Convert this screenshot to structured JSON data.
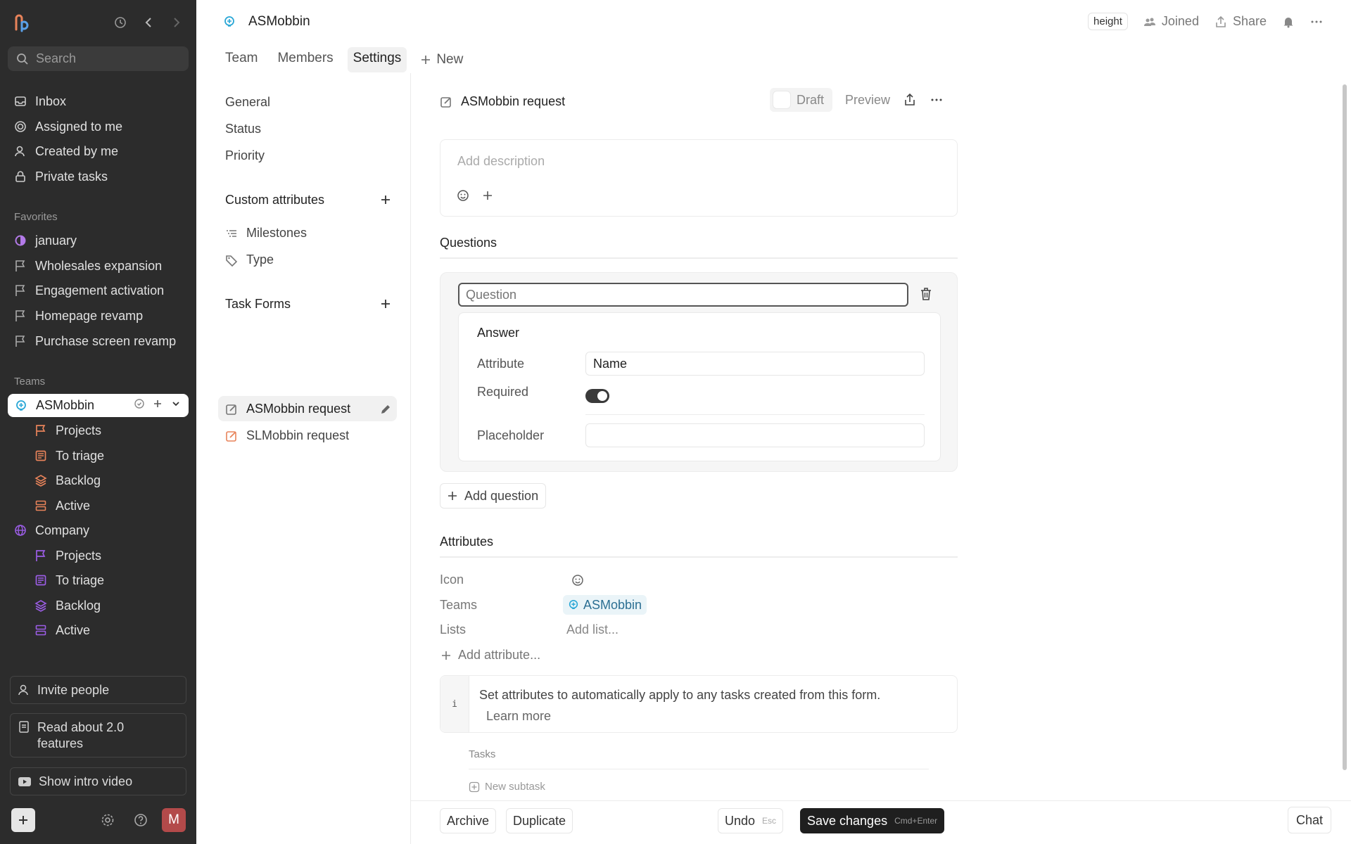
{
  "sidebar": {
    "search_placeholder": "Search",
    "nav": [
      {
        "label": "Inbox",
        "icon": "inbox-icon"
      },
      {
        "label": "Assigned to me",
        "icon": "target-icon"
      },
      {
        "label": "Created by me",
        "icon": "person-icon"
      },
      {
        "label": "Private tasks",
        "icon": "lock-icon"
      }
    ],
    "favorites_heading": "Favorites",
    "favorites": [
      {
        "label": "january",
        "icon": "circle-icon"
      },
      {
        "label": "Wholesales expansion",
        "icon": "flag-icon"
      },
      {
        "label": "Engagement activation",
        "icon": "flag-icon"
      },
      {
        "label": "Homepage revamp",
        "icon": "flag-icon"
      },
      {
        "label": "Purchase screen revamp",
        "icon": "flag-icon"
      }
    ],
    "teams_heading": "Teams",
    "team_active": "ASMobbin",
    "team_items": [
      "Projects",
      "To triage",
      "Backlog",
      "Active"
    ],
    "team2": "Company",
    "team2_items": [
      "Projects",
      "To triage",
      "Backlog",
      "Active"
    ],
    "invite": "Invite people",
    "read_about": "Read about 2.0 features",
    "intro_video": "Show intro video",
    "avatar_letter": "M",
    "colors": {
      "team1": "#e8835a",
      "team2": "#9b5de5",
      "accent": "#2aa7d6"
    }
  },
  "header": {
    "team_name": "ASMobbin",
    "height_badge": "height",
    "joined": "Joined",
    "share": "Share",
    "tabs": [
      "Team",
      "Members",
      "Settings"
    ],
    "new_tab": "New"
  },
  "settings_nav": {
    "items": [
      "General",
      "Status",
      "Priority"
    ],
    "custom_attributes": "Custom attributes",
    "attributes": [
      "Milestones",
      "Type"
    ],
    "task_forms": "Task Forms",
    "forms": [
      "ASMobbin request",
      "SLMobbin request"
    ]
  },
  "form": {
    "title": "ASMobbin request",
    "draft": "Draft",
    "preview": "Preview",
    "description_placeholder": "Add description",
    "questions_heading": "Questions",
    "question_placeholder": "Question",
    "answer_title": "Answer",
    "attribute_label": "Attribute",
    "attribute_value": "Name",
    "required_label": "Required",
    "required_on": true,
    "placeholder_label": "Placeholder",
    "placeholder_value": "",
    "add_question": "Add question",
    "attributes_heading": "Attributes",
    "icon_label": "Icon",
    "teams_label": "Teams",
    "teams_value": "ASMobbin",
    "lists_label": "Lists",
    "lists_value": "Add list...",
    "add_attribute": "Add attribute...",
    "info_glyph": "i",
    "info_text": "Set attributes to automatically apply to any tasks created from this form.",
    "learn_more": "Learn more",
    "tasks_label": "Tasks",
    "new_subtask": "New subtask"
  },
  "footer": {
    "archive": "Archive",
    "duplicate": "Duplicate",
    "undo": "Undo",
    "undo_key": "Esc",
    "save": "Save changes",
    "save_key": "Cmd+Enter",
    "chat": "Chat"
  }
}
